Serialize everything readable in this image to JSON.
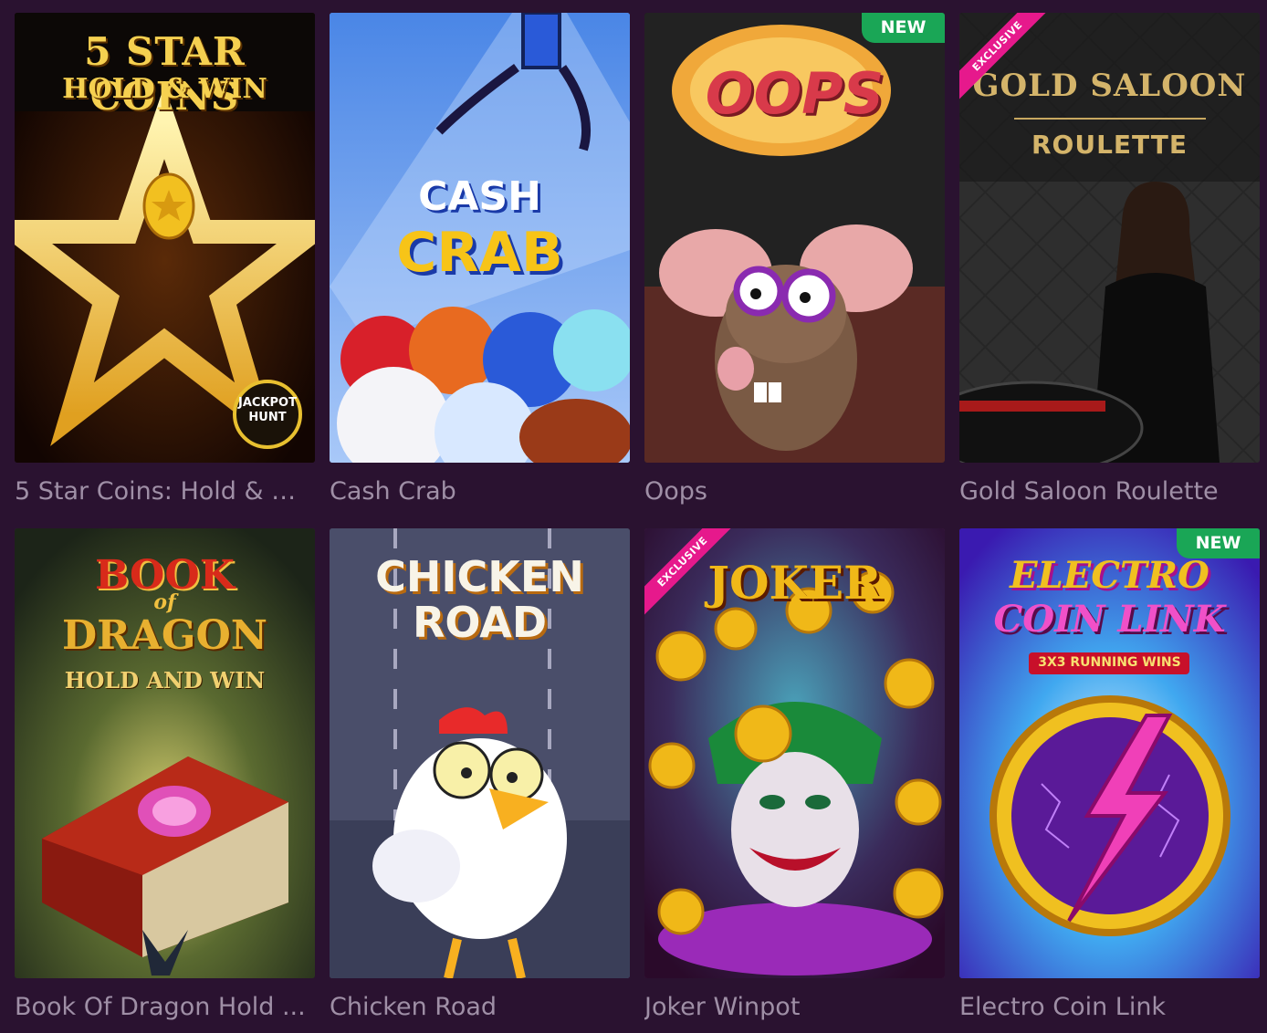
{
  "games": [
    {
      "title": "5 Star Coins: Hold & Win",
      "art_title": "5 STAR COINS",
      "art_subtitle": "HOLD & WIN",
      "art_extra": "JACKPOT HUNT",
      "badge": ""
    },
    {
      "title": "Cash Crab",
      "art_title": "CASH",
      "art_subtitle": "CRAB",
      "badge": ""
    },
    {
      "title": "Oops",
      "art_title": "OOPS",
      "badge": "NEW"
    },
    {
      "title": "Gold Saloon Roulette",
      "art_title": "GOLD SALOON",
      "art_subtitle": "ROULETTE",
      "badge": "EXCLUSIVE"
    },
    {
      "title": "Book Of Dragon Hold ...",
      "art_title": "BOOK",
      "art_of": "of",
      "art_subtitle": "DRAGON",
      "art_extra": "HOLD AND WIN",
      "badge": ""
    },
    {
      "title": "Chicken Road",
      "art_title": "CHICKEN",
      "art_subtitle": "ROAD",
      "badge": ""
    },
    {
      "title": "Joker Winpot",
      "art_title": "JOKER",
      "badge": "EXCLUSIVE"
    },
    {
      "title": "Electro Coin Link",
      "art_title": "ELECTRO",
      "art_subtitle": "COIN LINK",
      "art_extra": "3X3 RUNNING WINS",
      "badge": "NEW"
    }
  ],
  "colors": {
    "background": "#2a1230",
    "title_text": "#9f8fa6",
    "new_badge": "#1aa656",
    "exclusive_ribbon": "#e6198c"
  }
}
